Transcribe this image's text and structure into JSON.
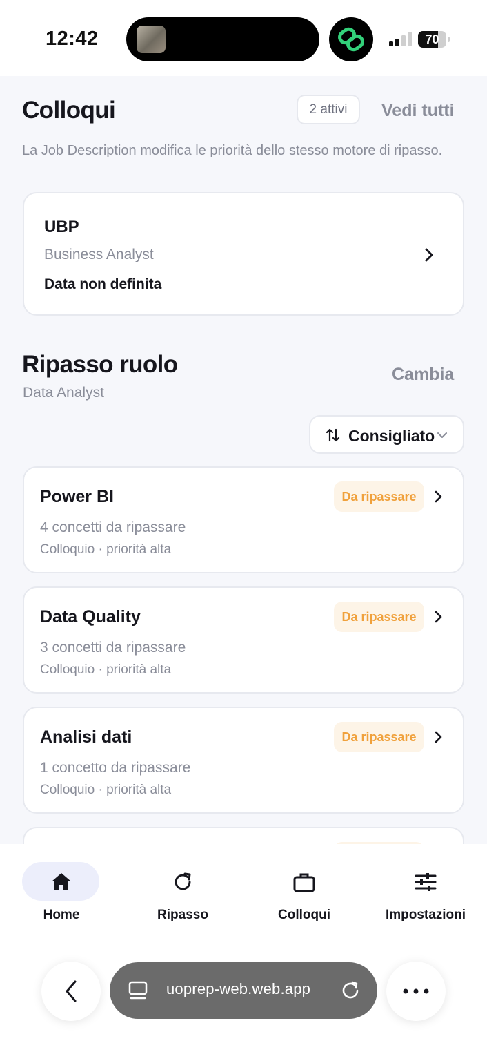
{
  "status_bar": {
    "time": "12:42",
    "battery": "70",
    "battery_level_percent": 70
  },
  "interviews": {
    "title": "Colloqui",
    "active_badge": "2 attivi",
    "see_all": "Vedi tutti",
    "description": "La Job Description modifica le priorità dello stesso motore di ripasso.",
    "card": {
      "company": "UBP",
      "role": "Business Analyst",
      "date": "Data non definita"
    }
  },
  "role_review": {
    "title": "Ripasso ruolo",
    "change": "Cambia",
    "role": "Data Analyst",
    "sort_label": "Consigliato",
    "topics": [
      {
        "title": "Power BI",
        "badge": "Da ripassare",
        "count": "4 concetti da ripassare",
        "meta": "Colloquio · priorità alta"
      },
      {
        "title": "Data Quality",
        "badge": "Da ripassare",
        "count": "3 concetti da ripassare",
        "meta": "Colloquio · priorità alta"
      },
      {
        "title": "Analisi dati",
        "badge": "Da ripassare",
        "count": "1 concetto da ripassare",
        "meta": "Colloquio · priorità alta"
      }
    ]
  },
  "bottom_nav": {
    "items": [
      {
        "label": "Home",
        "icon": "home-icon",
        "active": true
      },
      {
        "label": "Ripasso",
        "icon": "refresh-icon",
        "active": false
      },
      {
        "label": "Colloqui",
        "icon": "briefcase-icon",
        "active": false
      },
      {
        "label": "Impostazioni",
        "icon": "sliders-icon",
        "active": false
      }
    ]
  },
  "browser": {
    "url": "uoprep-web.web.app"
  },
  "colors": {
    "accent_badge_text": "#f0a13c",
    "accent_badge_bg": "#fdf4e7",
    "active_nav_bg": "#eceefb",
    "app_icon_green": "#33d17a"
  }
}
